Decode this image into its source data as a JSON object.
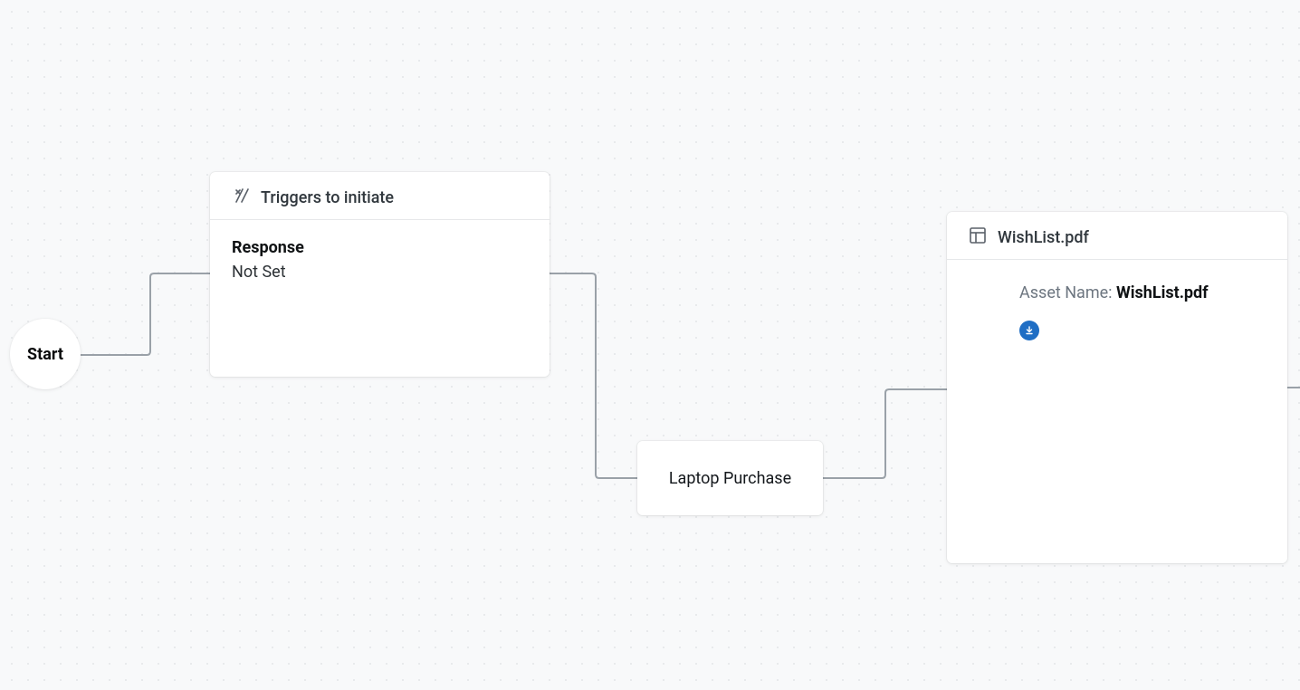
{
  "start": {
    "label": "Start"
  },
  "trigger_card": {
    "header": "Triggers to initiate",
    "response_label": "Response",
    "response_value": "Not Set"
  },
  "branch": {
    "label": "Laptop Purchase"
  },
  "asset_card": {
    "header": "WishList.pdf",
    "asset_name_label": "Asset Name: ",
    "asset_name_value": "WishList.pdf"
  }
}
